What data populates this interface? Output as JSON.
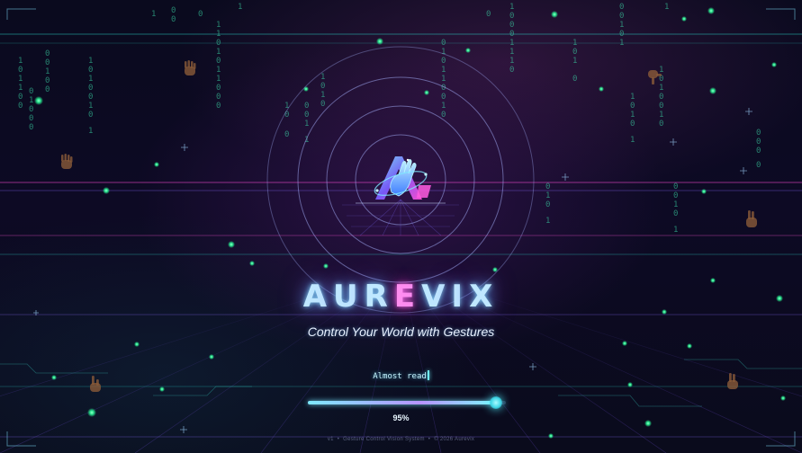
{
  "app": {
    "brand_letters": [
      "A",
      "U",
      "R",
      "E",
      "V",
      "I",
      "X"
    ],
    "brand_accent_letter": "E",
    "tagline": "Control Your World with Gestures"
  },
  "loader": {
    "status_text": "Almost read",
    "progress": 0.95,
    "progress_label": "95%"
  },
  "footer": {
    "version": "v1",
    "product": "Gesture Control Vision System",
    "copyright": "© 2026 Aurevix",
    "separator": "•"
  },
  "decor": {
    "binary_rain": [
      "1",
      "1",
      "0",
      "1",
      "1",
      "0",
      "0",
      "1",
      "0",
      "1",
      "0",
      "0",
      "1",
      "1",
      "0",
      "0",
      "1",
      "0",
      "1",
      "1",
      "0"
    ],
    "icons": [
      "hand-icon",
      "pinch-hand-icon",
      "point-hand-icon",
      "peace-hand-icon",
      "sparkle-icon"
    ]
  },
  "colors": {
    "background": "#0a0a1e",
    "cyan_glow": "#7ee9ff",
    "magenta_glow": "#ff5ce0",
    "particle_green": "#2bff9a",
    "hand_brown": "#8a5a38"
  }
}
